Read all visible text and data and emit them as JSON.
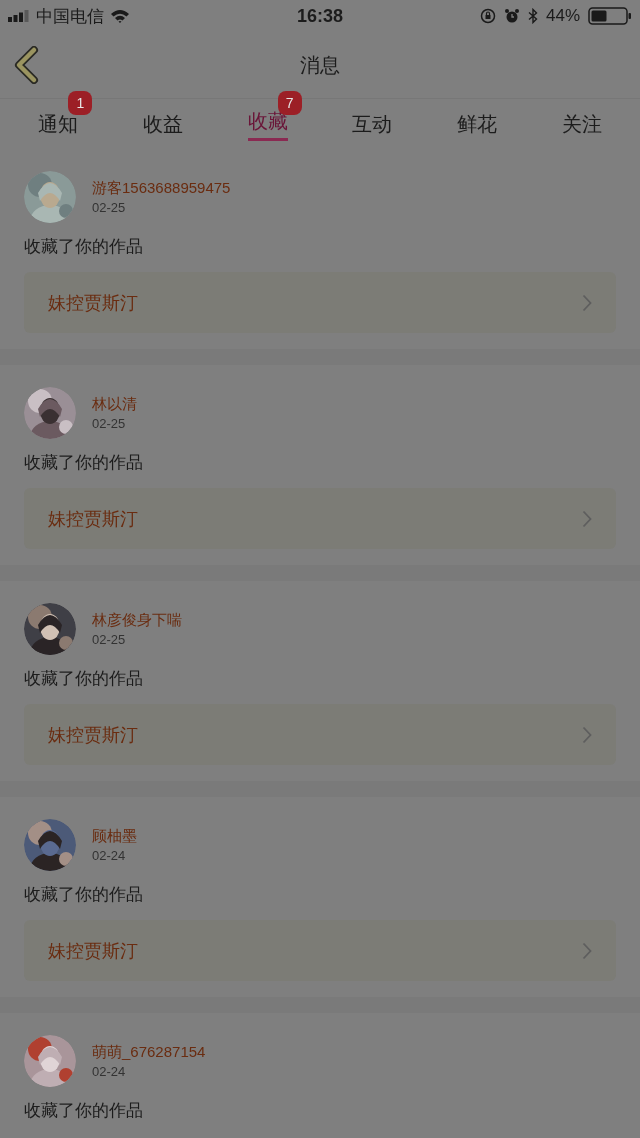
{
  "status_bar": {
    "carrier": "中国电信",
    "time": "16:38",
    "battery": "44%"
  },
  "nav": {
    "title": "消息"
  },
  "tabs": [
    {
      "label": "通知",
      "selected": false,
      "badge": "1"
    },
    {
      "label": "收益",
      "selected": false
    },
    {
      "label": "收藏",
      "selected": true,
      "badge": "7"
    },
    {
      "label": "互动",
      "selected": false
    },
    {
      "label": "鲜花",
      "selected": false
    },
    {
      "label": "关注",
      "selected": false
    }
  ],
  "messages": [
    {
      "name": "游客1563688959475",
      "date": "02-25",
      "action": "收藏了你的作品",
      "work": "妹控贾斯汀"
    },
    {
      "name": "林以清",
      "date": "02-25",
      "action": "收藏了你的作品",
      "work": "妹控贾斯汀"
    },
    {
      "name": "林彦俊身下喘",
      "date": "02-25",
      "action": "收藏了你的作品",
      "work": "妹控贾斯汀"
    },
    {
      "name": "顾柚墨",
      "date": "02-24",
      "action": "收藏了你的作品",
      "work": "妹控贾斯汀"
    },
    {
      "name": "萌萌_676287154",
      "date": "02-24",
      "action": "收藏了你的作品"
    }
  ]
}
